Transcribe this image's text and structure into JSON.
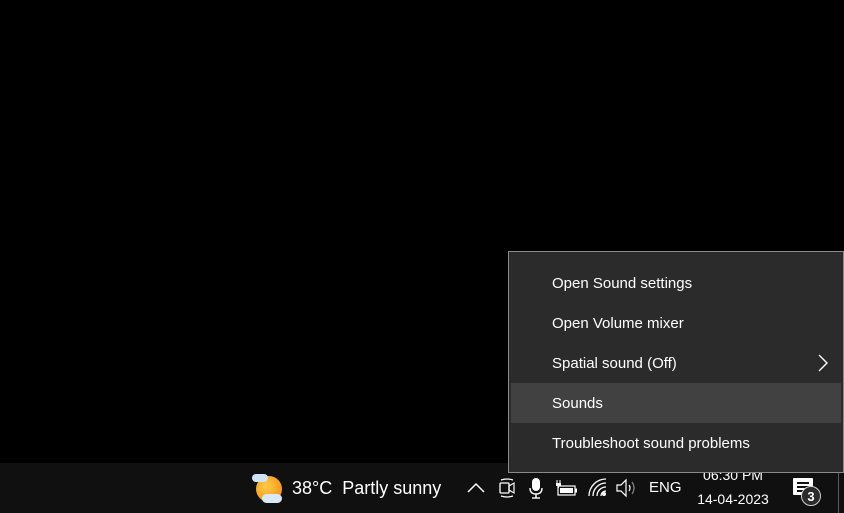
{
  "context_menu": {
    "items": [
      {
        "label": "Open Sound settings",
        "has_submenu": false,
        "highlighted": false
      },
      {
        "label": "Open Volume mixer",
        "has_submenu": false,
        "highlighted": false
      },
      {
        "label": "Spatial sound (Off)",
        "has_submenu": true,
        "highlighted": false
      },
      {
        "label": "Sounds",
        "has_submenu": false,
        "highlighted": true
      },
      {
        "label": "Troubleshoot sound problems",
        "has_submenu": false,
        "highlighted": false
      }
    ]
  },
  "taskbar": {
    "weather": {
      "icon": "partly-sunny-icon",
      "temperature": "38°C",
      "description": "Partly sunny"
    },
    "tray_icons": [
      {
        "name": "show-hidden-icons",
        "icon": "chevron-up-icon"
      },
      {
        "name": "camera",
        "icon": "camera-icon"
      },
      {
        "name": "microphone",
        "icon": "microphone-icon"
      },
      {
        "name": "battery",
        "icon": "battery-charging-icon"
      },
      {
        "name": "wifi",
        "icon": "wifi-icon"
      },
      {
        "name": "volume",
        "icon": "speaker-icon"
      }
    ],
    "language": "ENG",
    "clock": {
      "time": "06:30 PM",
      "date": "14-04-2023"
    },
    "notifications": {
      "icon": "action-center-icon",
      "count": "3"
    }
  },
  "colors": {
    "menu_bg": "#2b2b2b",
    "menu_hover": "#414141",
    "menu_border": "#8a8a8a",
    "taskbar_bg": "#101010",
    "desktop_bg": "#000000"
  }
}
